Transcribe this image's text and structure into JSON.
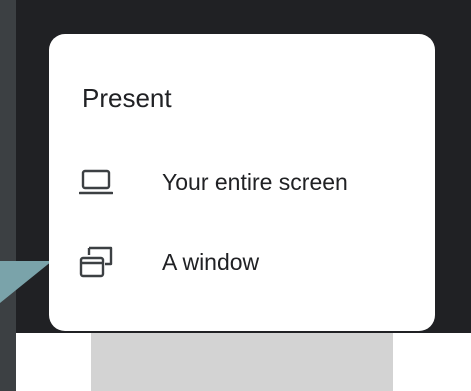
{
  "present_menu": {
    "title": "Present",
    "items": [
      {
        "label": "Your entire screen",
        "icon": "laptop-icon"
      },
      {
        "label": "A window",
        "icon": "window-icon"
      }
    ]
  },
  "colors": {
    "overlay_background": "#202124",
    "menu_background": "#ffffff",
    "text": "#202124",
    "icon": "#3c4043",
    "pointer": "#7aa3aa"
  }
}
